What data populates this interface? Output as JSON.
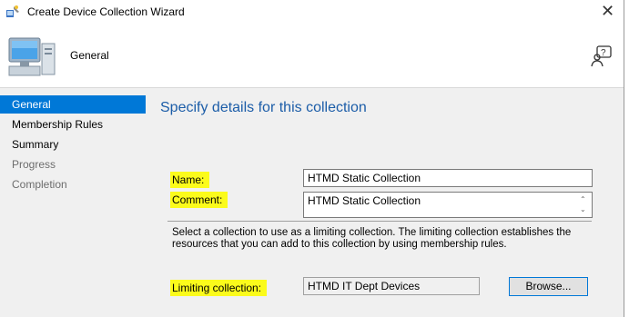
{
  "window": {
    "title": "Create Device Collection Wizard"
  },
  "header": {
    "title": "General"
  },
  "nav": {
    "items": [
      {
        "label": "General",
        "state": "active"
      },
      {
        "label": "Membership Rules",
        "state": "normal"
      },
      {
        "label": "Summary",
        "state": "normal"
      },
      {
        "label": "Progress",
        "state": "disabled"
      },
      {
        "label": "Completion",
        "state": "disabled"
      }
    ]
  },
  "main": {
    "heading": "Specify details for this collection",
    "name_label": "Name:",
    "name_value": "HTMD Static Collection",
    "comment_label": "Comment:",
    "comment_value": "HTMD Static Collection",
    "limiting_description": "Select a collection to use as a limiting collection. The limiting collection establishes the resources that you can add to this collection by using membership rules.",
    "limiting_label": "Limiting collection:",
    "limiting_value": "HTMD IT Dept Devices",
    "browse_label": "Browse..."
  },
  "colors": {
    "accent": "#0078d7",
    "heading": "#1c5da8",
    "highlight": "#fbfb1b",
    "panel": "#f0f0f0"
  },
  "icons": [
    "wizard-icon",
    "computer-icon",
    "help-icon",
    "close-icon"
  ]
}
